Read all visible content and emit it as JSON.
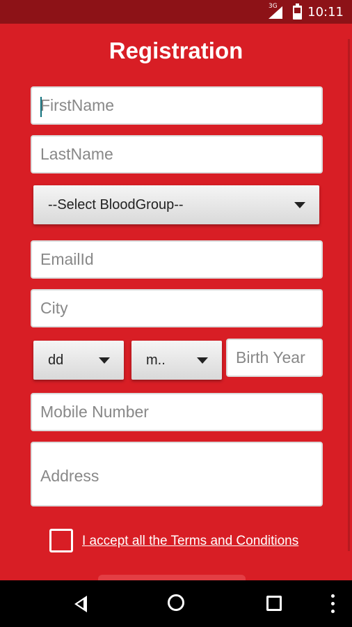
{
  "status_bar": {
    "network": "3G",
    "time": "10:11"
  },
  "form": {
    "title": "Registration",
    "first_name": {
      "placeholder": "FirstName",
      "value": ""
    },
    "last_name": {
      "placeholder": "LastName",
      "value": ""
    },
    "blood_group": {
      "selected": "--Select BloodGroup--"
    },
    "email": {
      "placeholder": "EmailId",
      "value": ""
    },
    "city": {
      "placeholder": "City",
      "value": ""
    },
    "dob": {
      "day": "dd",
      "month": "m..",
      "year_placeholder": "Birth Year"
    },
    "mobile": {
      "placeholder": "Mobile Number",
      "value": ""
    },
    "address": {
      "placeholder": "Address",
      "value": ""
    },
    "terms": {
      "label": "I accept all the Terms and Conditions",
      "checked": false
    }
  },
  "nav_bar": {
    "icons": [
      "back-icon",
      "home-icon",
      "recent-apps-icon",
      "overflow-menu-icon"
    ]
  },
  "colors": {
    "background": "#d81e25",
    "status_bar": "#8d1217",
    "cursor": "#0e6f7b"
  }
}
